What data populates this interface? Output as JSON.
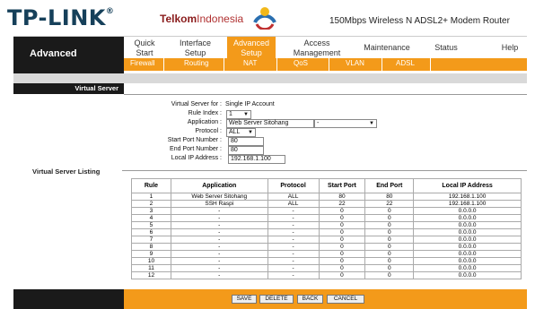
{
  "brand": {
    "logo": "TP-LINK",
    "reg": "®",
    "telkom_a": "Telkom",
    "telkom_b": "Indonesia",
    "model": "150Mbps Wireless N ADSL2+ Modem Router"
  },
  "nav": {
    "section": "Advanced",
    "tabs": [
      {
        "l1": "Quick",
        "l2": "Start"
      },
      {
        "l1": "Interface",
        "l2": "Setup"
      },
      {
        "l1": "Advanced",
        "l2": "Setup"
      },
      {
        "l1": "Access",
        "l2": "Management"
      },
      {
        "l1": "Maintenance",
        "l2": ""
      },
      {
        "l1": "Status",
        "l2": ""
      },
      {
        "l1": "Help",
        "l2": ""
      }
    ],
    "subtabs": [
      "Firewall",
      "Routing",
      "NAT",
      "QoS",
      "VLAN",
      "ADSL"
    ]
  },
  "virtual_server": {
    "section_label": "Virtual Server",
    "for_label": "Virtual Server for :",
    "for_value": "Single IP Account",
    "rule_index_label": "Rule Index :",
    "rule_index_value": "1",
    "application_label": "Application :",
    "application_value": "Web Server Sitohang",
    "application_select": "-",
    "protocol_label": "Protocol :",
    "protocol_value": "ALL",
    "start_port_label": "Start Port Number :",
    "start_port_value": "80",
    "end_port_label": "End Port Number :",
    "end_port_value": "80",
    "local_ip_label": "Local IP Address :",
    "local_ip_value": "192.168.1.100"
  },
  "listing": {
    "label": "Virtual Server Listing",
    "headers": [
      "Rule",
      "Application",
      "Protocol",
      "Start Port",
      "End Port",
      "Local IP Address"
    ],
    "rows": [
      [
        "1",
        "Web Server Sitohang",
        "ALL",
        "80",
        "80",
        "192.168.1.100"
      ],
      [
        "2",
        "SSH Raspi",
        "ALL",
        "22",
        "22",
        "192.168.1.100"
      ],
      [
        "3",
        "-",
        "-",
        "0",
        "0",
        "0.0.0.0"
      ],
      [
        "4",
        "-",
        "-",
        "0",
        "0",
        "0.0.0.0"
      ],
      [
        "5",
        "-",
        "-",
        "0",
        "0",
        "0.0.0.0"
      ],
      [
        "6",
        "-",
        "-",
        "0",
        "0",
        "0.0.0.0"
      ],
      [
        "7",
        "-",
        "-",
        "0",
        "0",
        "0.0.0.0"
      ],
      [
        "8",
        "-",
        "-",
        "0",
        "0",
        "0.0.0.0"
      ],
      [
        "9",
        "-",
        "-",
        "0",
        "0",
        "0.0.0.0"
      ],
      [
        "10",
        "-",
        "-",
        "0",
        "0",
        "0.0.0.0"
      ],
      [
        "11",
        "-",
        "-",
        "0",
        "0",
        "0.0.0.0"
      ],
      [
        "12",
        "-",
        "-",
        "0",
        "0",
        "0.0.0.0"
      ]
    ]
  },
  "buttons": {
    "save": "SAVE",
    "delete": "DELETE",
    "back": "BACK",
    "cancel": "CANCEL"
  },
  "colors": {
    "accent": "#f39a1a",
    "dark": "#1a1a1a",
    "brand": "#16405a"
  }
}
